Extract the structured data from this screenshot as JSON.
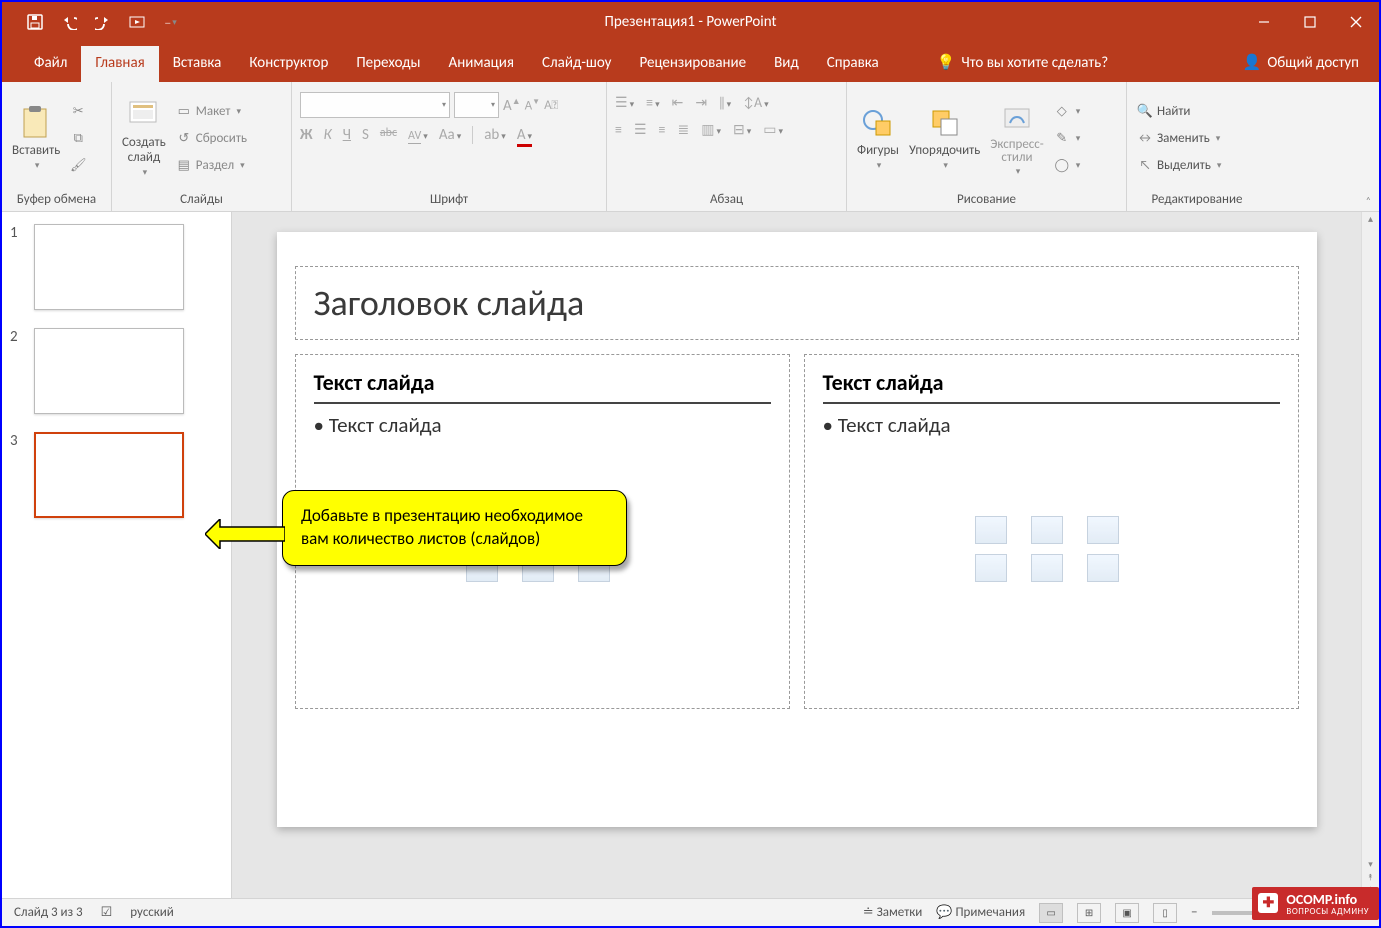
{
  "titlebar": {
    "title": "Презентация1 - PowerPoint"
  },
  "tabs": {
    "file": "Файл",
    "home": "Главная",
    "insert": "Вставка",
    "design": "Конструктор",
    "transitions": "Переходы",
    "animations": "Анимация",
    "slideshow": "Слайд-шоу",
    "review": "Рецензирование",
    "view": "Вид",
    "help": "Справка",
    "tellme": "Что вы хотите сделать?",
    "share": "Общий доступ"
  },
  "ribbon": {
    "clipboard": {
      "paste": "Вставить",
      "label": "Буфер обмена"
    },
    "slides": {
      "new_slide": "Создать\nслайд",
      "layout": "Макет",
      "reset": "Сбросить",
      "section": "Раздел",
      "label": "Слайды"
    },
    "font": {
      "bold": "Ж",
      "italic": "К",
      "underline": "Ч",
      "shadow": "S",
      "strike": "abc",
      "spacing": "AV",
      "case": "Aa",
      "inc": "A",
      "dec": "A",
      "label": "Шрифт"
    },
    "paragraph": {
      "label": "Абзац"
    },
    "drawing": {
      "shapes": "Фигуры",
      "arrange": "Упорядочить",
      "quickstyles": "Экспресс-\nстили",
      "label": "Рисование"
    },
    "editing": {
      "find": "Найти",
      "replace": "Заменить",
      "select": "Выделить",
      "label": "Редактирование"
    }
  },
  "thumbnails": {
    "n1": "1",
    "n2": "2",
    "n3": "3"
  },
  "slide": {
    "title": "Заголовок слайда",
    "content_head": "Текст слайда",
    "content_bullet": "Текст слайда"
  },
  "callout": {
    "text": "Добавьте в презентацию необходимое вам количество листов (слайдов)"
  },
  "statusbar": {
    "slide_info": "Слайд 3 из 3",
    "lang": "русский",
    "notes": "Заметки",
    "comments": "Примечания"
  },
  "watermark": {
    "line1": "OCOMP.info",
    "line2": "ВОПРОСЫ АДМИНУ"
  }
}
